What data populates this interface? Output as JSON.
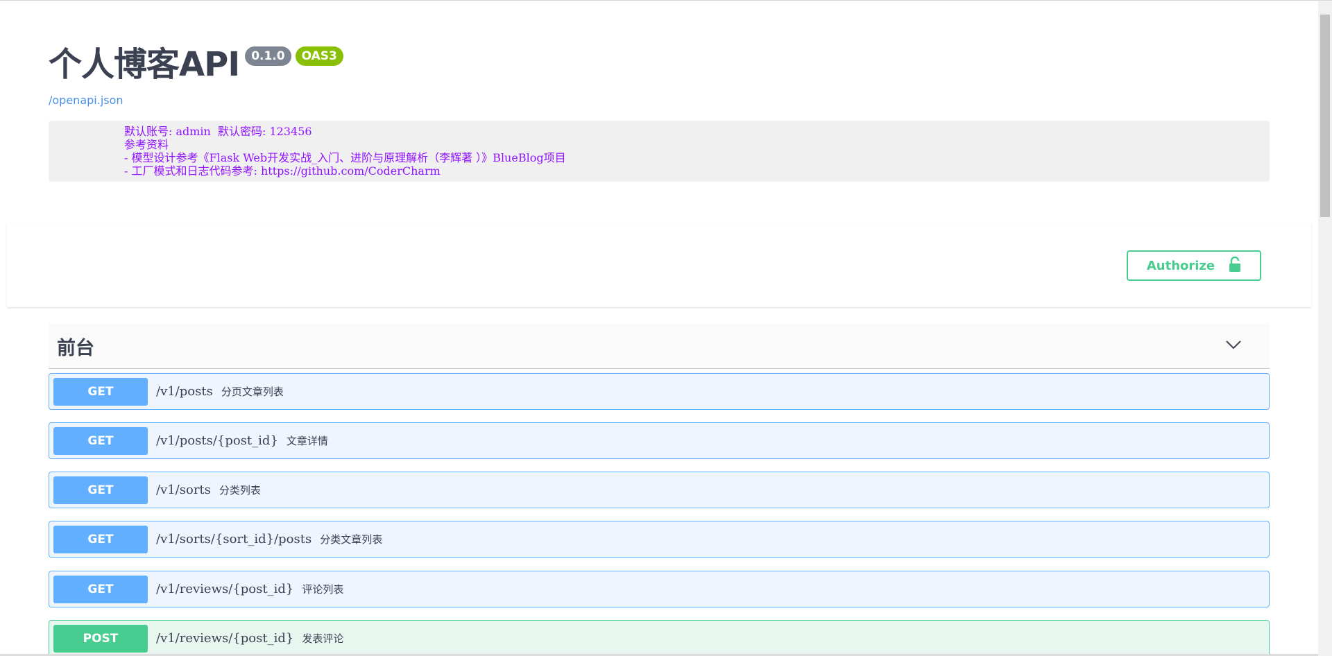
{
  "info": {
    "title": "个人博客API",
    "version": "0.1.0",
    "oas": "OAS3",
    "spec_link": "/openapi.json"
  },
  "description": {
    "lines": [
      "默认账号: admin  默认密码: 123456",
      "参考资料",
      "- 模型设计参考《Flask Web开发实战_入门、进阶与原理解析（李辉著 ）》BlueBlog项目",
      "- 工厂模式和日志代码参考: https://github.com/CoderCharm"
    ]
  },
  "authorize": {
    "label": "Authorize",
    "icon": "unlock-icon"
  },
  "section": {
    "title": "前台",
    "icon": "chevron-down-icon"
  },
  "operations": [
    {
      "method": "GET",
      "path": "/v1/posts",
      "summary": "分页文章列表"
    },
    {
      "method": "GET",
      "path": "/v1/posts/{post_id}",
      "summary": "文章详情"
    },
    {
      "method": "GET",
      "path": "/v1/sorts",
      "summary": "分类列表"
    },
    {
      "method": "GET",
      "path": "/v1/sorts/{sort_id}/posts",
      "summary": "分类文章列表"
    },
    {
      "method": "GET",
      "path": "/v1/reviews/{post_id}",
      "summary": "评论列表"
    },
    {
      "method": "POST",
      "path": "/v1/reviews/{post_id}",
      "summary": "发表评论"
    }
  ],
  "colors": {
    "get": "#61affe",
    "post": "#49cc90",
    "accent": "#49cc90",
    "link": "#4990e2",
    "desc_text": "#9012fe"
  }
}
